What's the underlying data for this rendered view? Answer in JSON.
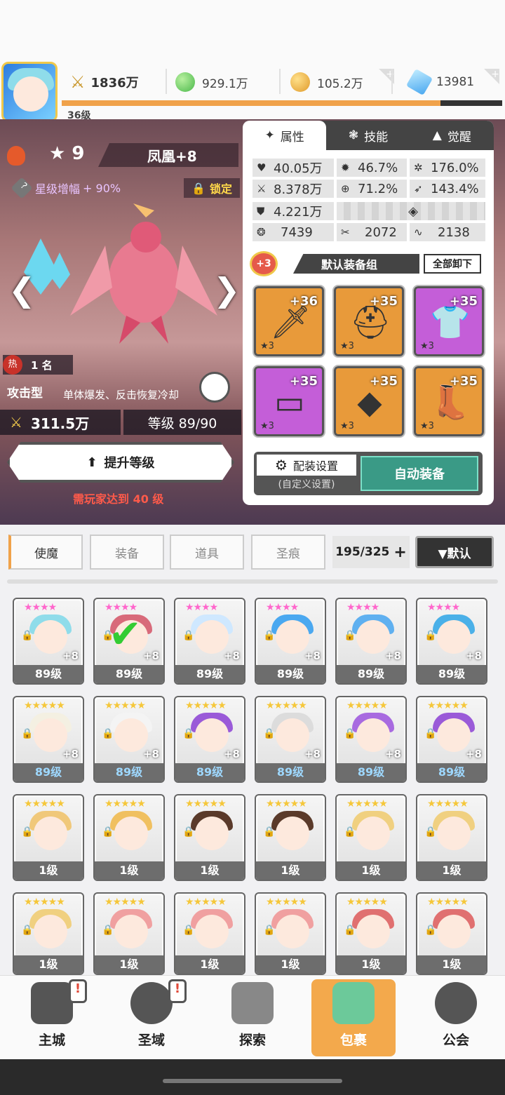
{
  "top": {
    "level": "36级",
    "power": "1836万",
    "green_currency": "929.1万",
    "gold_currency": "105.2万",
    "gem_currency": "13981"
  },
  "hero": {
    "star_count": "★ 9",
    "name": "凤凰+8",
    "star_boost_label": "星级增幅",
    "star_boost_value": "+ 90%",
    "lock_label": "锁定",
    "rank_icon": "热",
    "rank": "1 名",
    "role": "攻击型",
    "role_desc": "单体爆发、反击恢复冷却",
    "power": "311.5万",
    "level": "等级 89/90",
    "upgrade_label": "提升等级",
    "requirement": "需玩家达到 40 级"
  },
  "panel": {
    "tabs": [
      "属性",
      "技能",
      "觉醒"
    ],
    "stats": {
      "hp": "40.05万",
      "crit": "46.7%",
      "crit_dmg": "176.0%",
      "atk": "8.378万",
      "accuracy": "71.2%",
      "speed": "143.4%",
      "def": "4.221万",
      "s1": "7439",
      "s2": "2072",
      "s3": "2138"
    },
    "equip_set_bonus": "+3",
    "equip_set_name": "默认装备组",
    "unequip_all": "全部卸下",
    "equipment": [
      {
        "plus": "+36",
        "stars": "★3",
        "rarity": "orange",
        "icon": "sword-icon"
      },
      {
        "plus": "+35",
        "stars": "★3",
        "rarity": "orange",
        "icon": "helmet-icon"
      },
      {
        "plus": "+35",
        "stars": "★3",
        "rarity": "purple",
        "icon": "armor-icon"
      },
      {
        "plus": "+35",
        "stars": "★3",
        "rarity": "purple",
        "icon": "belt-icon"
      },
      {
        "plus": "+35",
        "stars": "★3",
        "rarity": "orange",
        "icon": "necklace-icon"
      },
      {
        "plus": "+35",
        "stars": "★3",
        "rarity": "orange",
        "icon": "boots-icon"
      }
    ],
    "config_label": "配装设置",
    "config_sub": "(自定义设置)",
    "auto_equip": "自动装备"
  },
  "inventory": {
    "tabs": [
      "使魔",
      "装备",
      "道具",
      "圣痕"
    ],
    "count": "195/325",
    "count_plus": "+",
    "sort_label": "▼默认",
    "rows": [
      [
        {
          "lvl": "89级",
          "stars": "★★★★",
          "plus": "+8",
          "hair": "#8fdcea"
        },
        {
          "lvl": "89级",
          "stars": "★★★★",
          "plus": "+8",
          "hair": "#d86a7a"
        },
        {
          "lvl": "89级",
          "stars": "★★★★",
          "plus": "+8",
          "hair": "#cfe8ff"
        },
        {
          "lvl": "89级",
          "stars": "★★★★",
          "plus": "+8",
          "hair": "#4aa8f0"
        },
        {
          "lvl": "89级",
          "stars": "★★★★",
          "plus": "+8",
          "hair": "#5fb0f0"
        },
        {
          "lvl": "89级",
          "stars": "★★★★",
          "plus": "+8",
          "hair": "#4ab0e8"
        }
      ],
      [
        {
          "lvl": "89级",
          "stars": "★★★★★",
          "plus": "+8",
          "hair": "#f4f0e2"
        },
        {
          "lvl": "89级",
          "stars": "★★★★★",
          "plus": "+8",
          "hair": "#f4f4f4"
        },
        {
          "lvl": "89级",
          "stars": "★★★★★",
          "plus": "+8",
          "hair": "#9a5ad8"
        },
        {
          "lvl": "89级",
          "stars": "★★★★★",
          "plus": "+8",
          "hair": "#dcdcdc"
        },
        {
          "lvl": "89级",
          "stars": "★★★★★",
          "plus": "+8",
          "hair": "#a86ae0"
        },
        {
          "lvl": "89级",
          "stars": "★★★★★",
          "plus": "+8",
          "hair": "#9a5ad8"
        }
      ],
      [
        {
          "lvl": "1级",
          "stars": "★★★★★",
          "plus": "",
          "hair": "#f0c87a"
        },
        {
          "lvl": "1级",
          "stars": "★★★★★",
          "plus": "",
          "hair": "#f0c060"
        },
        {
          "lvl": "1级",
          "stars": "★★★★★",
          "plus": "",
          "hair": "#5a3a2a"
        },
        {
          "lvl": "1级",
          "stars": "★★★★★",
          "plus": "",
          "hair": "#5a3a2a"
        },
        {
          "lvl": "1级",
          "stars": "★★★★★",
          "plus": "",
          "hair": "#f0d080"
        },
        {
          "lvl": "1级",
          "stars": "★★★★★",
          "plus": "",
          "hair": "#f0d080"
        }
      ],
      [
        {
          "lvl": "1级",
          "stars": "★★★★★",
          "plus": "",
          "hair": "#f0d080"
        },
        {
          "lvl": "1级",
          "stars": "★★★★★",
          "plus": "",
          "hair": "#f0a0a0"
        },
        {
          "lvl": "1级",
          "stars": "★★★★★",
          "plus": "",
          "hair": "#f0a0a0"
        },
        {
          "lvl": "1级",
          "stars": "★★★★★",
          "plus": "",
          "hair": "#f0a0a0"
        },
        {
          "lvl": "1级",
          "stars": "★★★★★",
          "plus": "",
          "hair": "#e07070"
        },
        {
          "lvl": "1级",
          "stars": "★★★★★",
          "plus": "",
          "hair": "#e07070"
        }
      ]
    ]
  },
  "nav": [
    "主城",
    "圣域",
    "探索",
    "包裹",
    "公会"
  ],
  "colors": {
    "accent": "#f3a94c",
    "auto": "#3a9a86",
    "warn": "#ff5a4a"
  }
}
